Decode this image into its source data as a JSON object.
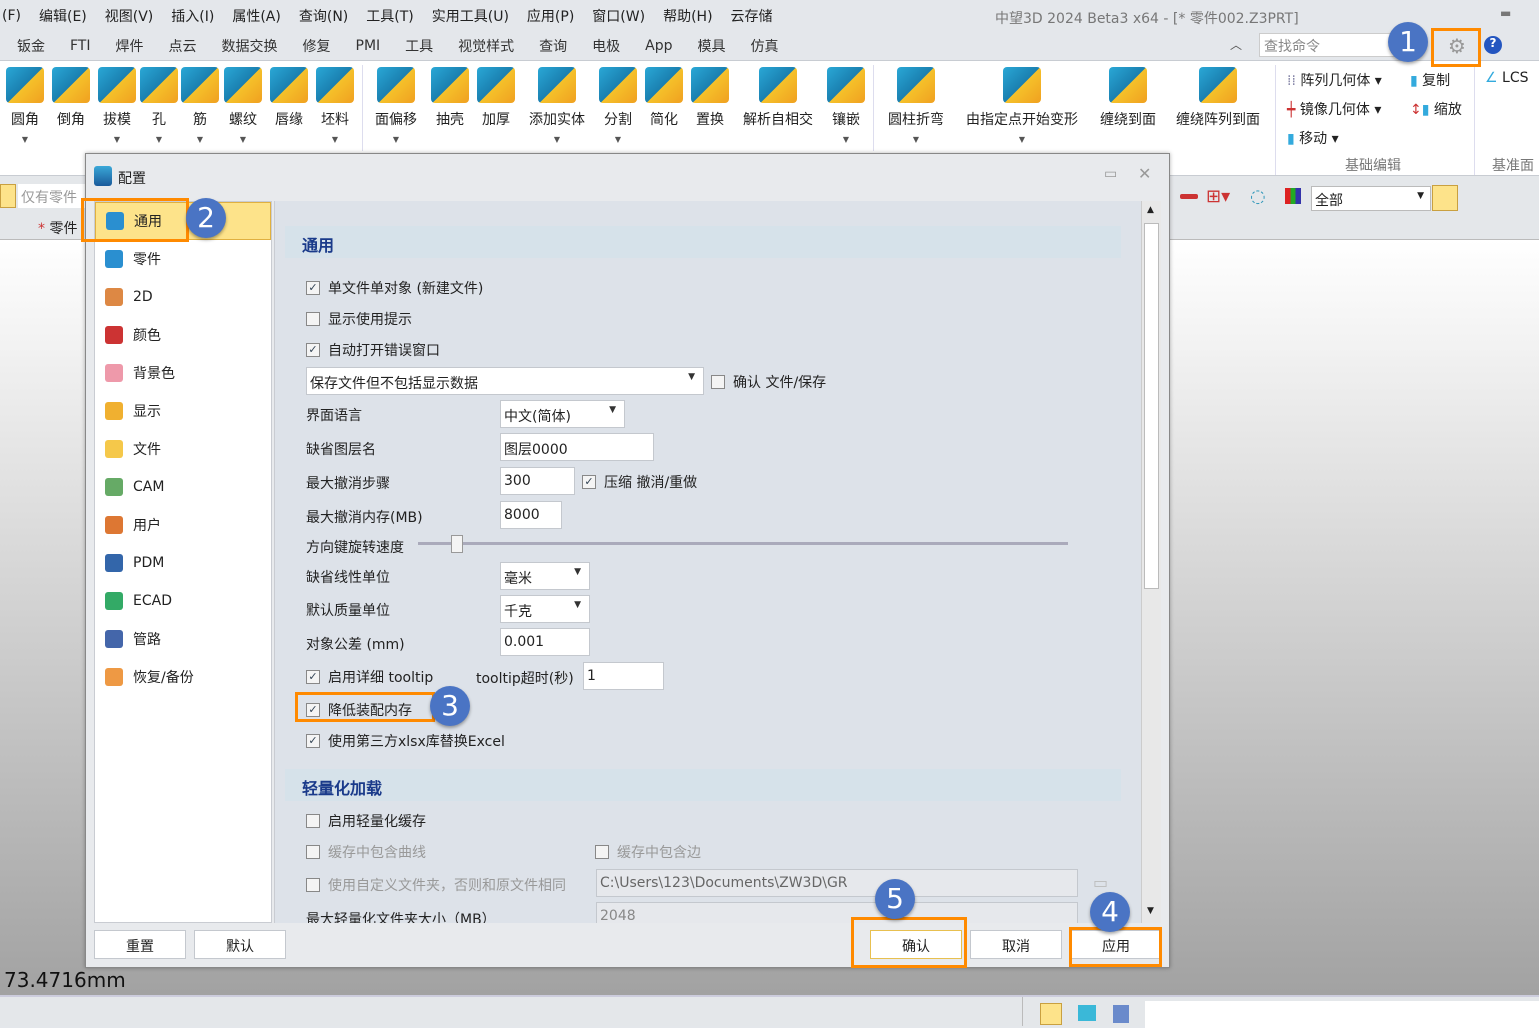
{
  "app": {
    "title": "中望3D 2024 Beta3 x64 - [* 零件002.Z3PRT]"
  },
  "menu": [
    "(F)",
    "编辑(E)",
    "视图(V)",
    "插入(I)",
    "属性(A)",
    "查询(N)",
    "工具(T)",
    "实用工具(U)",
    "应用(P)",
    "窗口(W)",
    "帮助(H)",
    "云存储"
  ],
  "tabs": [
    "钣金",
    "FTI",
    "焊件",
    "点云",
    "数据交换",
    "修复",
    "PMI",
    "工具",
    "视觉样式",
    "查询",
    "电极",
    "App",
    "模具",
    "仿真"
  ],
  "search_placeholder": "查找命令",
  "ribbon": [
    {
      "label": "圆角",
      "dd": true
    },
    {
      "label": "倒角",
      "dd": false
    },
    {
      "label": "拔模",
      "dd": true
    },
    {
      "label": "孔",
      "dd": true
    },
    {
      "label": "筋",
      "dd": true
    },
    {
      "label": "螺纹",
      "dd": true
    },
    {
      "label": "唇缘",
      "dd": false
    },
    {
      "label": "坯料",
      "dd": true
    },
    {
      "label": "面偏移",
      "dd": true
    },
    {
      "label": "抽壳",
      "dd": false
    },
    {
      "label": "加厚",
      "dd": false
    },
    {
      "label": "添加实体",
      "dd": true
    },
    {
      "label": "分割",
      "dd": true
    },
    {
      "label": "简化",
      "dd": false
    },
    {
      "label": "置换",
      "dd": false
    },
    {
      "label": "解析自相交",
      "dd": false
    },
    {
      "label": "镶嵌",
      "dd": true
    },
    {
      "label": "圆柱折弯",
      "dd": true
    },
    {
      "label": "由指定点开始变形",
      "dd": true
    },
    {
      "label": "缠绕到面",
      "dd": false
    },
    {
      "label": "缠绕阵列到面",
      "dd": false
    }
  ],
  "ribbon_side": {
    "pattern": "阵列几何体",
    "mirror": "镜像几何体",
    "move": "移动",
    "copy": "复制",
    "scale": "缩放",
    "lcs": "LCS",
    "group1": "基础编辑",
    "group2": "基准面"
  },
  "toolbar2": {
    "filter_left": "仅有零件",
    "tree_item": "零件",
    "filter_value": "全部"
  },
  "coord": "73.4716mm",
  "dialog": {
    "title": "配置",
    "nav": [
      "通用",
      "零件",
      "2D",
      "颜色",
      "背景色",
      "显示",
      "文件",
      "CAM",
      "用户",
      "PDM",
      "ECAD",
      "管路",
      "恢复/备份"
    ],
    "nav_selected": "通用",
    "section1": "通用",
    "single_file": {
      "label": "单文件单对象 (新建文件)",
      "checked": true
    },
    "show_hints": {
      "label": "显示使用提示",
      "checked": false
    },
    "auto_error": {
      "label": "自动打开错误窗口",
      "checked": true
    },
    "save_mode": "保存文件但不包括显示数据",
    "confirm_save": {
      "label": "确认 文件/保存",
      "checked": false
    },
    "language": {
      "label": "界面语言",
      "value": "中文(简体)"
    },
    "layer_name": {
      "label": "缺省图层名",
      "value": "图层0000"
    },
    "undo_steps": {
      "label": "最大撤消步骤",
      "value": "300"
    },
    "compress_undo": {
      "label": "压缩 撤消/重做",
      "checked": true
    },
    "undo_mem": {
      "label": "最大撤消内存(MB)",
      "value": "8000"
    },
    "rotate_speed": {
      "label": "方向键旋转速度",
      "value_fraction": 0.05
    },
    "linear_unit": {
      "label": "缺省线性单位",
      "value": "毫米"
    },
    "mass_unit": {
      "label": "默认质量单位",
      "value": "千克"
    },
    "tolerance": {
      "label": "对象公差  (mm)",
      "value": "0.001"
    },
    "tooltip": {
      "label": "启用详细 tooltip",
      "checked": true
    },
    "tooltip_timeout": {
      "label": "tooltip超时(秒)",
      "value": "1"
    },
    "reduce_mem": {
      "label": "降低装配内存",
      "checked": true
    },
    "xlsx": {
      "label": "使用第三方xlsx库替换Excel",
      "checked": true
    },
    "section2": "轻量化加载",
    "light_cache": {
      "label": "启用轻量化缓存",
      "checked": false
    },
    "cache_curves": {
      "label": "缓存中包含曲线",
      "checked": false
    },
    "cache_edges": {
      "label": "缓存中包含边",
      "checked": false
    },
    "custom_folder": {
      "label": "使用自定义文件夹，否则和原文件相同",
      "checked": false,
      "value": "C:\\Users\\123\\Documents\\ZW3D\\GR"
    },
    "max_size": {
      "label": "最大轻量化文件夹大小（MB）",
      "value": "2048"
    },
    "buttons": {
      "reset": "重置",
      "default": "默认",
      "ok": "确认",
      "cancel": "取消",
      "apply": "应用"
    }
  },
  "badges": [
    "1",
    "2",
    "3",
    "4",
    "5"
  ],
  "colors": {
    "highlight": "#ff8a00",
    "badge": "#4a74c4",
    "nav_selected": "#fde38a"
  }
}
